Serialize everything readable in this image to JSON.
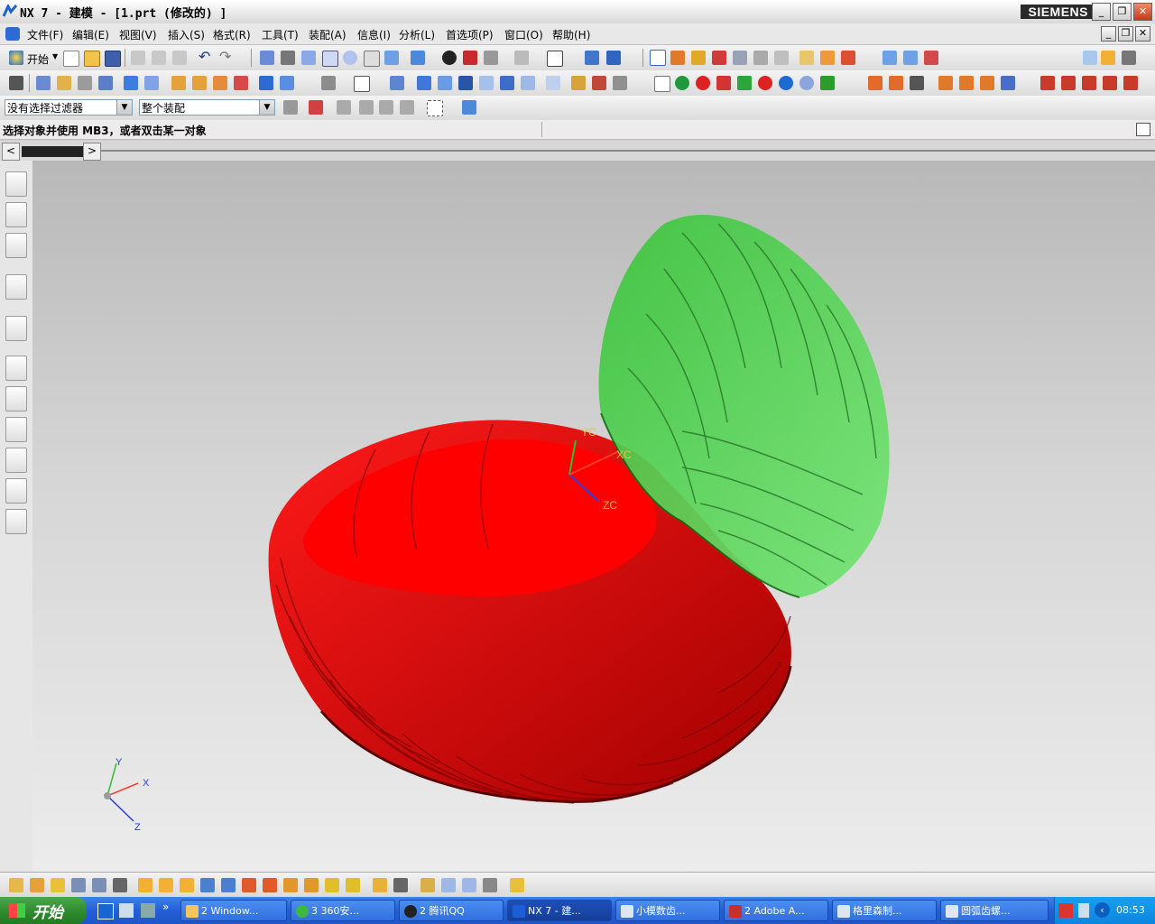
{
  "window": {
    "title": "NX 7 - 建模 - [1.prt  (修改的) ]",
    "brand": "SIEMENS"
  },
  "menu": [
    "文件(F)",
    "编辑(E)",
    "视图(V)",
    "插入(S)",
    "格式(R)",
    "工具(T)",
    "装配(A)",
    "信息(I)",
    "分析(L)",
    "首选项(P)",
    "窗口(O)",
    "帮助(H)"
  ],
  "toolbar": {
    "start_label": "开始"
  },
  "filters": {
    "selection_filter": "没有选择过滤器",
    "scope": "整个装配"
  },
  "status": {
    "message": "选择对象并使用 MB3，或者双击某一对象"
  },
  "viewport": {
    "wcs_labels": {
      "xc": "XC",
      "yc": "YC",
      "zc": "ZC"
    },
    "triad_labels": {
      "x": "X",
      "y": "Y",
      "z": "Z"
    },
    "colors": {
      "gear_large": "#ff0000",
      "gear_pinion": "#3fd23f",
      "background_top": "#b8b8b8",
      "background_bottom": "#ececec"
    }
  },
  "taskbar": {
    "start_label": "开始",
    "tasks": [
      "2 Window...",
      "3 360安...",
      "2 腾讯QQ",
      "NX 7 - 建...",
      "小模数齿...",
      "2 Adobe A...",
      "格里森制...",
      "圆弧齿螺..."
    ],
    "clock": "08:53"
  },
  "icons": [
    "nx-logo-icon",
    "start-icon",
    "new-file-icon",
    "open-folder-icon",
    "save-icon",
    "cut-icon",
    "copy-icon",
    "paste-icon",
    "undo-icon",
    "redo-icon",
    "fit-icon",
    "zoom-icon",
    "rotate-icon",
    "cube-icon",
    "sketch-icon",
    "extrude-icon",
    "hole-icon",
    "measure-icon",
    "history-clock-icon",
    "part-navigator-icon",
    "assembly-navigator-icon",
    "roles-icon",
    "palette-icon"
  ]
}
